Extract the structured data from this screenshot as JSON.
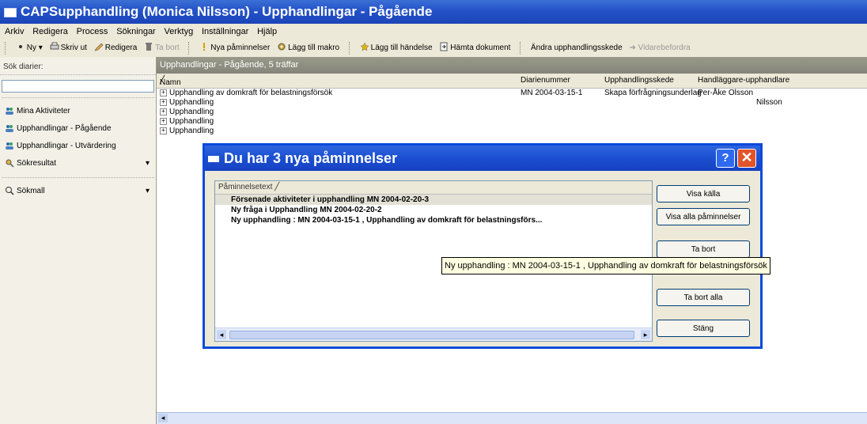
{
  "window": {
    "title": "CAPSupphandling (Monica Nilsson) - Upphandlingar - Pågående"
  },
  "menu": [
    "Arkiv",
    "Redigera",
    "Process",
    "Sökningar",
    "Verktyg",
    "Inställningar",
    "Hjälp"
  ],
  "toolbar": {
    "new": "Ny",
    "print": "Skriv ut",
    "edit": "Redigera",
    "delete": "Ta bort",
    "new_reminders": "Nya påminnelser",
    "add_macro": "Lägg till makro",
    "add_event": "Lägg till händelse",
    "fetch_document": "Hämta dokument",
    "change_stage": "Ändra upphandlingsskede",
    "forward": "Vidarebefordra"
  },
  "sidebar": {
    "search_label": "Sök diarier:",
    "items": [
      {
        "label": "Mina Aktiviteter",
        "has_arrow": false
      },
      {
        "label": "Upphandlingar - Pågående",
        "has_arrow": false
      },
      {
        "label": "Upphandlingar - Utvärdering",
        "has_arrow": false
      },
      {
        "label": "Sökresultat",
        "has_arrow": true
      },
      {
        "label": "Sökmall",
        "has_arrow": true
      }
    ]
  },
  "main": {
    "header": "Upphandlingar - Pågående, 5 träffar",
    "columns": [
      "Namn",
      "Diarienummer",
      "Upphandlingsskede",
      "Handläggare-upphandlare"
    ],
    "rows": [
      {
        "name": "Upphandling av domkraft för belastningsförsök",
        "diarienummer": "MN 2004-03-15-1",
        "skede": "Skapa förfrågningsunderlag",
        "handlaggare": "Per-Åke Olsson"
      },
      {
        "name": "Upphandling",
        "diarienummer": "",
        "skede": "",
        "handlaggare": "Nilsson"
      },
      {
        "name": "Upphandling",
        "diarienummer": "",
        "skede": "",
        "handlaggare": ""
      },
      {
        "name": "Upphandling",
        "diarienummer": "",
        "skede": "",
        "handlaggare": ""
      },
      {
        "name": "Upphandling",
        "diarienummer": "",
        "skede": "",
        "handlaggare": ""
      }
    ]
  },
  "dialog": {
    "title": "Du har 3 nya påminnelser",
    "column_header": "Påminnelsetext",
    "items": [
      "Försenade aktiviteter i upphandling MN 2004-02-20-3",
      "Ny fråga i Upphandling MN 2004-02-20-2",
      "Ny upphandling : MN 2004-03-15-1 , Upphandling av domkraft för belastningsförs..."
    ],
    "buttons": {
      "show_source": "Visa källa",
      "show_all": "Visa alla påminnelser",
      "delete": "Ta bort",
      "delete_all": "Ta bort alla",
      "close": "Stäng"
    },
    "tooltip": "Ny upphandling : MN 2004-03-15-1 , Upphandling av domkraft för belastningsförsök"
  },
  "colors": {
    "titlebar": "#2452c8",
    "dialog_border": "#0b4adb",
    "close_button": "#e2542a",
    "tooltip_bg": "#ffffe1"
  }
}
